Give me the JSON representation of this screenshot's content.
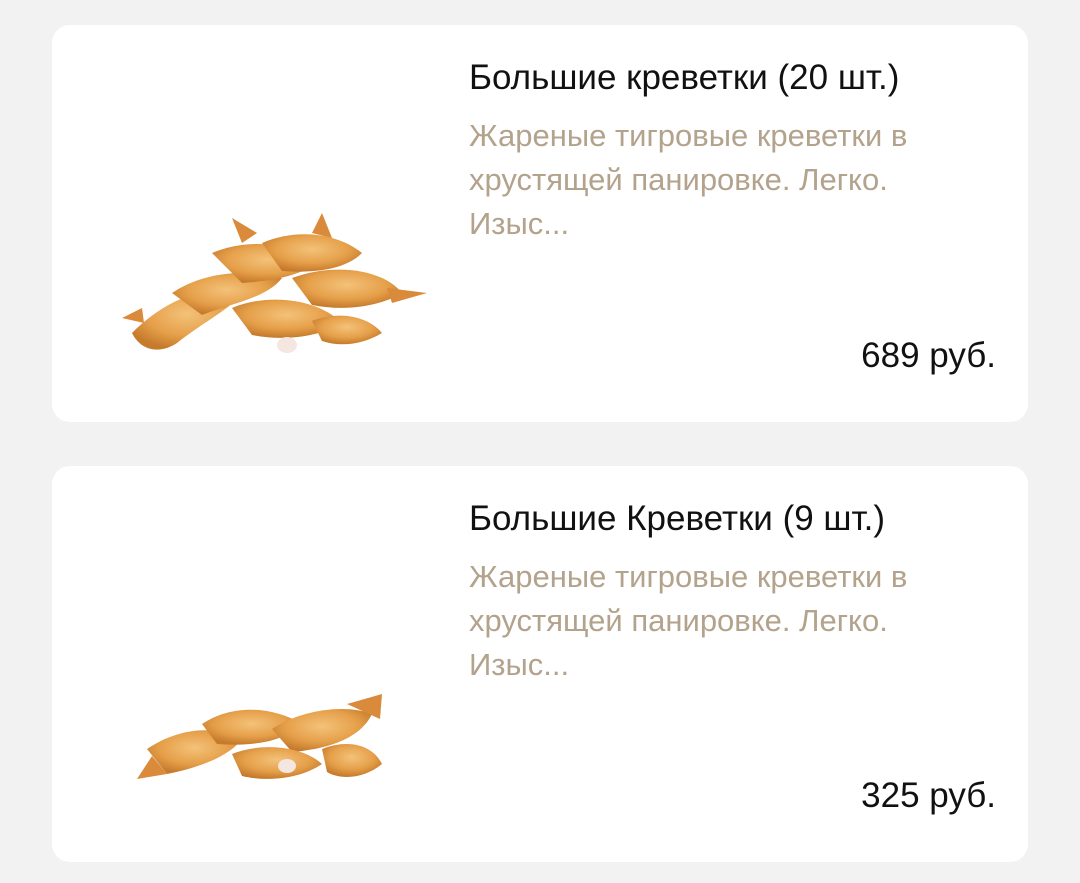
{
  "products": [
    {
      "title": "Большие креветки (20 шт.)",
      "description": "Жареные тигровые креветки в\nхрустящей панировке. Легко.\nИзыс...",
      "price": "689 руб.",
      "image_icon": "fried-shrimp-image"
    },
    {
      "title": "Большие Креветки (9 шт.)",
      "description": "Жареные тигровые креветки в\nхрустящей панировке. Легко.\nИзыс...",
      "price": "325 руб.",
      "image_icon": "fried-shrimp-image"
    }
  ],
  "colors": {
    "background": "#f2f2f2",
    "card": "#ffffff",
    "title_text": "#111111",
    "description_text": "#b3a28c",
    "price_text": "#111111",
    "shrimp_fill": "#e8a24a",
    "shrimp_shadow": "#c9782c"
  }
}
